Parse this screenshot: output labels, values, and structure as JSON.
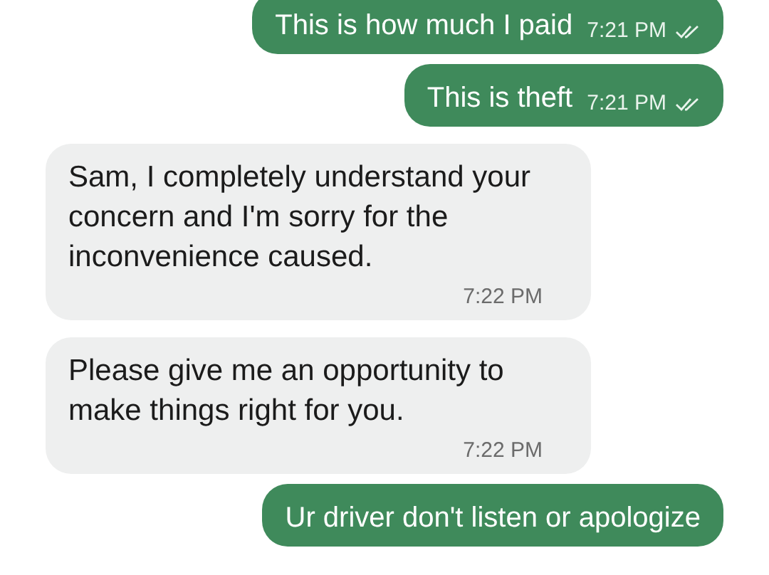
{
  "messages": [
    {
      "kind": "outgoing",
      "text": "This is how much I paid",
      "time": "7:21 PM",
      "read": true
    },
    {
      "kind": "outgoing",
      "text": "This is theft",
      "time": "7:21 PM",
      "read": true
    },
    {
      "kind": "incoming",
      "text": "Sam, I completely understand your concern and I'm sorry for the inconvenience caused.",
      "time": "7:22 PM"
    },
    {
      "kind": "incoming",
      "text": "Please give me an opportunity to make things right for you.",
      "time": "7:22 PM"
    },
    {
      "kind": "outgoing",
      "text": "Ur driver don't listen or apologize"
    }
  ]
}
